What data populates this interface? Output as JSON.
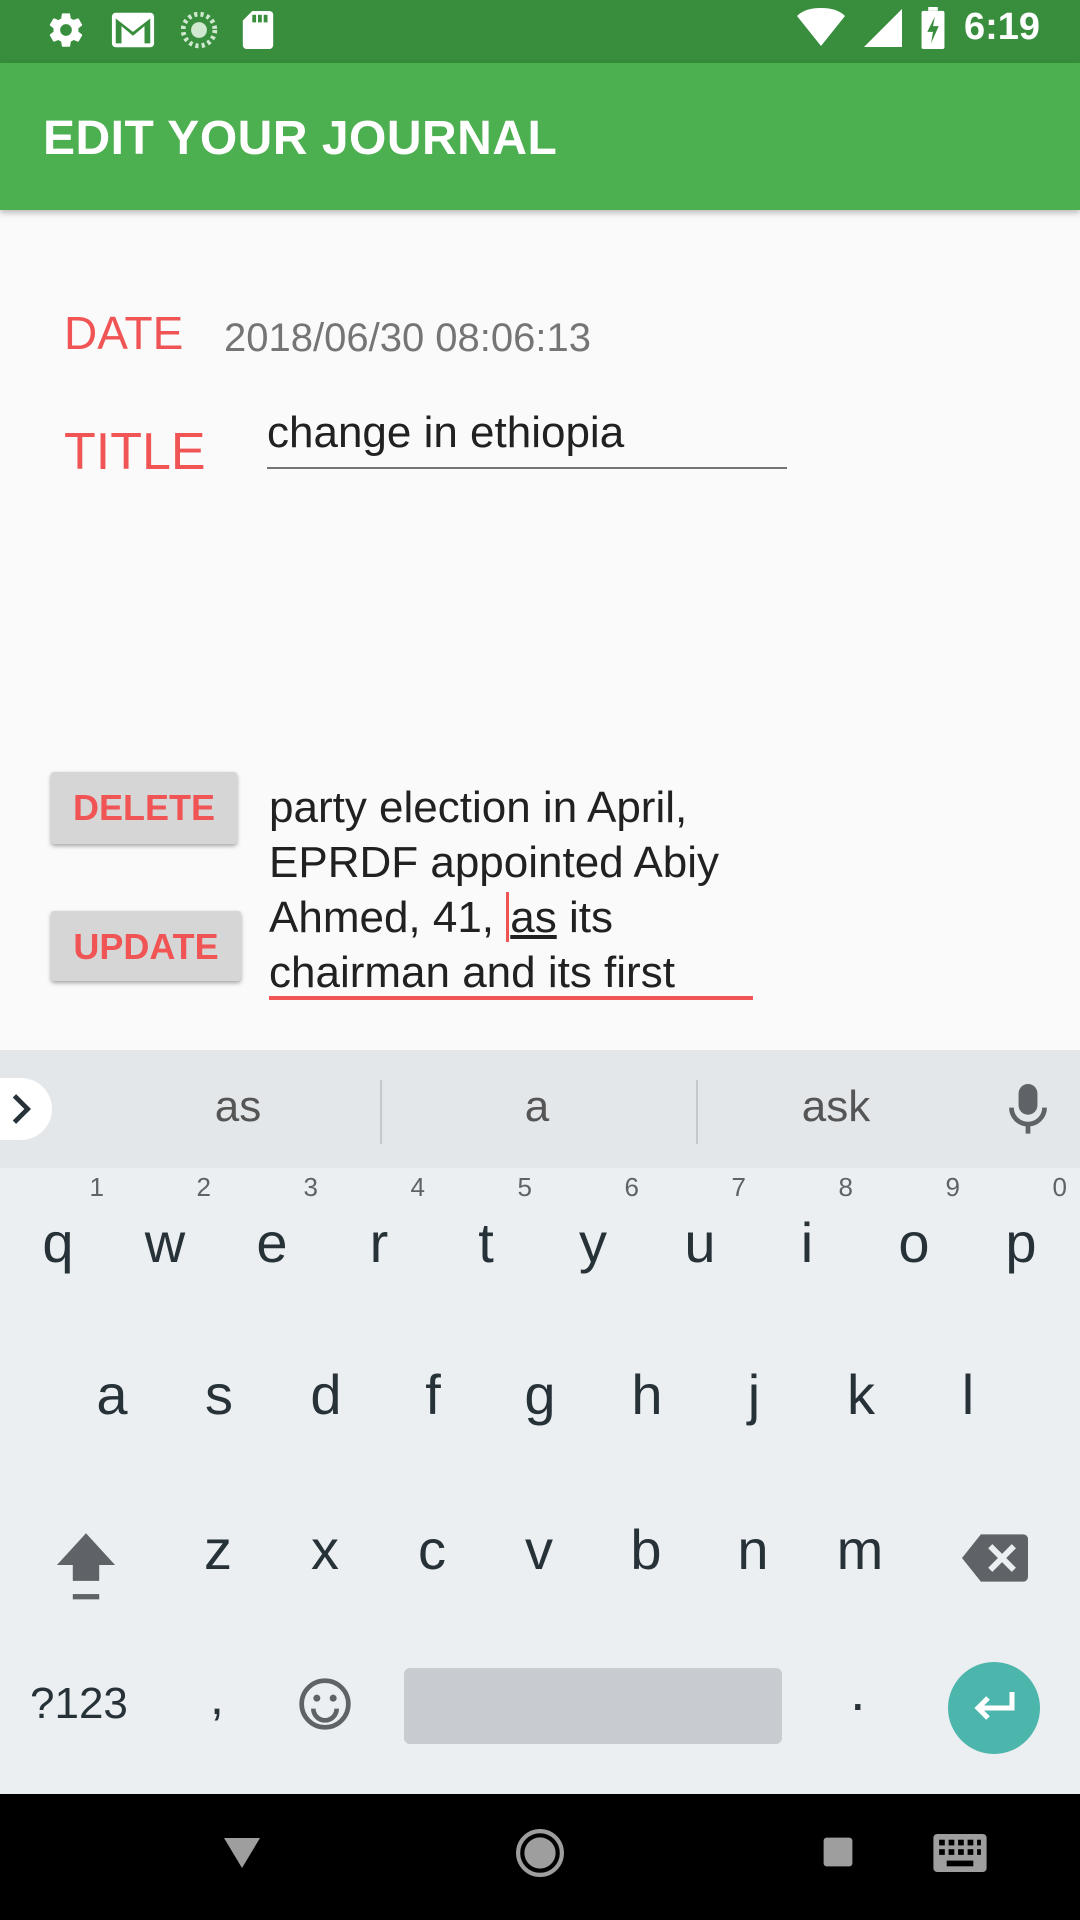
{
  "status_bar": {
    "time": "6:19",
    "icons_left": [
      "settings-icon",
      "gmail-icon",
      "sync-icon",
      "sd-card-icon"
    ],
    "icons_right": [
      "wifi-icon",
      "signal-icon",
      "battery-charging-icon"
    ]
  },
  "app_bar": {
    "title": "EDIT YOUR JOURNAL"
  },
  "form": {
    "date_label": "DATE",
    "date_value": "2018/06/30 08:06:13",
    "title_label": "TITLE",
    "title_value": "change in ethiopia",
    "body_before_cursor": "party election in April, EPRDF appointed Abiy Ahmed, 41, ",
    "body_composing": "as",
    "body_after": " its chairman and its first",
    "delete_label": "DELETE",
    "update_label": "UPDATE"
  },
  "keyboard": {
    "suggestions": [
      "as",
      "a",
      "ask"
    ],
    "row1": [
      {
        "key": "q",
        "hint": "1"
      },
      {
        "key": "w",
        "hint": "2"
      },
      {
        "key": "e",
        "hint": "3"
      },
      {
        "key": "r",
        "hint": "4"
      },
      {
        "key": "t",
        "hint": "5"
      },
      {
        "key": "y",
        "hint": "6"
      },
      {
        "key": "u",
        "hint": "7"
      },
      {
        "key": "i",
        "hint": "8"
      },
      {
        "key": "o",
        "hint": "9"
      },
      {
        "key": "p",
        "hint": "0"
      }
    ],
    "row2": [
      "a",
      "s",
      "d",
      "f",
      "g",
      "h",
      "j",
      "k",
      "l"
    ],
    "row3": [
      "z",
      "x",
      "c",
      "v",
      "b",
      "n",
      "m"
    ],
    "symbols_label": "?123",
    "comma": ",",
    "period": ".",
    "colors": {
      "accent": "#4db6ac",
      "background": "#eceff1"
    }
  },
  "nav_bar": {
    "icons": [
      "back-icon",
      "home-icon",
      "recents-icon",
      "keyboard-switch-icon"
    ]
  },
  "colors": {
    "primary": "#4caf50",
    "primary_dark": "#388e3c",
    "label_red": "#f05454"
  }
}
